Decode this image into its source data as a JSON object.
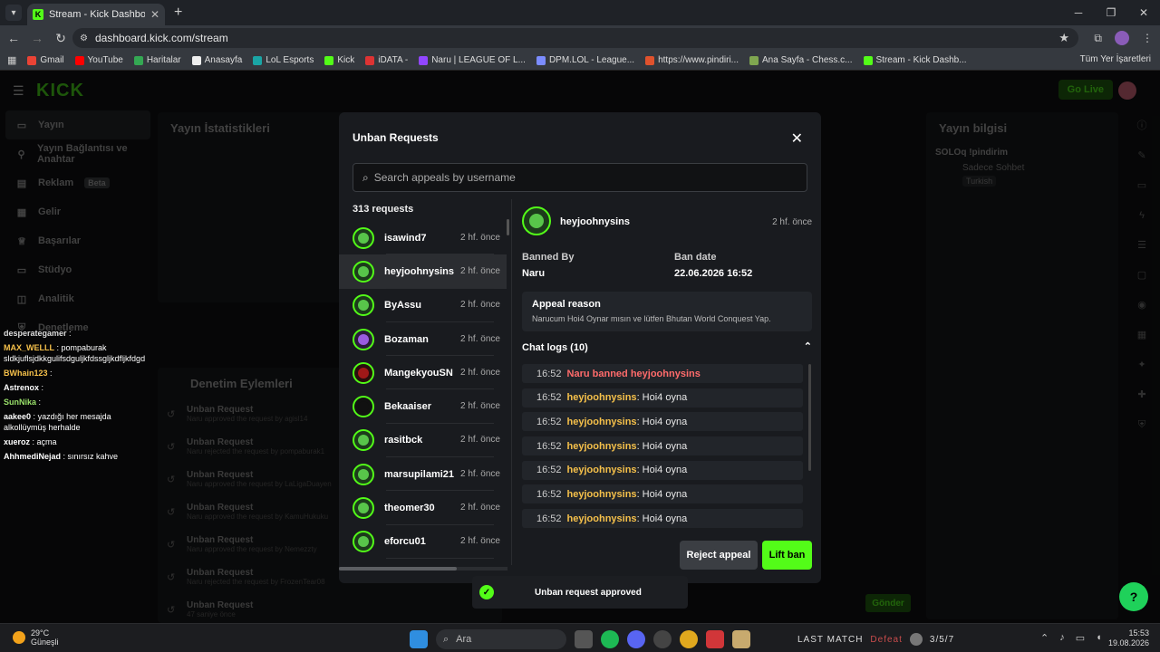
{
  "browser": {
    "tab_title": "Stream - Kick Dashboard",
    "url": "dashboard.kick.com/stream",
    "bookmarks": [
      "Gmail",
      "YouTube",
      "Haritalar",
      "Anasayfa",
      "LoL Esports",
      "Kick",
      "iDATA -",
      "Naru | LEAGUE OF L...",
      "DPM.LOL - League...",
      "https://www.pindiri...",
      "Ana Sayfa - Chess.c...",
      "Stream - Kick Dashb..."
    ],
    "all_bookmarks": "Tüm Yer İşaretleri"
  },
  "kick": {
    "go_live": "Go Live",
    "sidebar": [
      "Yayın",
      "Yayın Bağlantısı ve Anahtar",
      "Reklam",
      "Gelir",
      "Başarılar",
      "Stüdyo",
      "Analitik",
      "Denetleme"
    ],
    "sidebar_badge": "Beta",
    "stats_title": "Yayın İstatistikleri",
    "mod_title": "Denetim Eylemleri",
    "mod_rows": [
      {
        "title": "Unban Request",
        "sub": "Naru approved the request by agisl14"
      },
      {
        "title": "Unban Request",
        "sub": "Naru rejected the request by pompaburak1"
      },
      {
        "title": "Unban Request",
        "sub": "Naru approved the request by LaLigaDuayen"
      },
      {
        "title": "Unban Request",
        "sub": "Naru approved the request by KamuHukuku"
      },
      {
        "title": "Unban Request",
        "sub": "Naru approved the request by Nemezzty"
      },
      {
        "title": "Unban Request",
        "sub": "Naru rejected the request by FrozenTear08"
      },
      {
        "title": "Unban Request",
        "sub": "47 saniye önce"
      }
    ],
    "info_title": "Yayın bilgisi",
    "info_stream": "SOLOq !pindirim",
    "info_cat": "Sadece Sohbet",
    "info_tag": "Turkish",
    "send": "Gönder",
    "chat_overlay": [
      {
        "name": "desperategamer",
        "msg": ""
      },
      {
        "name": "MAX_WELLL",
        "msg": "pompaburak sldkjuflsjdkkgulifsdguljkfdssgljkdfljkfdgd"
      },
      {
        "name": "BWhain123",
        "msg": ""
      },
      {
        "name": "Astrenox",
        "msg": ""
      },
      {
        "name": "SunNika",
        "msg": ""
      },
      {
        "name": "aakee0",
        "msg": "yazdığı her mesajda alkollüymüş herhalde"
      },
      {
        "name": "xueroz",
        "msg": "açma"
      },
      {
        "name": "AhhmediNejad",
        "msg": "sınırsız kahve"
      }
    ]
  },
  "modal": {
    "title": "Unban Requests",
    "search_placeholder": "Search appeals by username",
    "count": "313 requests",
    "requests": [
      {
        "name": "isawind7",
        "ago": "2 hf. önce"
      },
      {
        "name": "heyjoohnysins",
        "ago": "2 hf. önce"
      },
      {
        "name": "ByAssu",
        "ago": "2 hf. önce"
      },
      {
        "name": "Bozaman",
        "ago": "2 hf. önce"
      },
      {
        "name": "MangekyouSN",
        "ago": "2 hf. önce"
      },
      {
        "name": "Bekaaiser",
        "ago": "2 hf. önce"
      },
      {
        "name": "rasitbck",
        "ago": "2 hf. önce"
      },
      {
        "name": "marsupilami21",
        "ago": "2 hf. önce"
      },
      {
        "name": "theomer30",
        "ago": "2 hf. önce"
      },
      {
        "name": "eforcu01",
        "ago": "2 hf. önce"
      }
    ],
    "selected": {
      "name": "heyjoohnysins",
      "ago": "2 hf. önce",
      "banned_by_label": "Banned By",
      "banned_by": "Naru",
      "ban_date_label": "Ban date",
      "ban_date": "22.06.2026 16:52",
      "reason_label": "Appeal reason",
      "reason": "Narucum Hoi4 Oynar mısın ve lütfen Bhutan World Conquest Yap.",
      "chat_logs_label": "Chat logs (10)",
      "logs": [
        {
          "time": "16:52",
          "user": "Naru banned heyjoohnysins",
          "msg": "",
          "type": "ban"
        },
        {
          "time": "16:52",
          "user": "heyjoohnysins",
          "msg": ": Hoi4 oyna",
          "type": "msg"
        },
        {
          "time": "16:52",
          "user": "heyjoohnysins",
          "msg": ": Hoi4 oyna",
          "type": "msg"
        },
        {
          "time": "16:52",
          "user": "heyjoohnysins",
          "msg": ": Hoi4 oyna",
          "type": "msg"
        },
        {
          "time": "16:52",
          "user": "heyjoohnysins",
          "msg": ": Hoi4 oyna",
          "type": "msg"
        },
        {
          "time": "16:52",
          "user": "heyjoohnysins",
          "msg": ": Hoi4 oyna",
          "type": "msg"
        },
        {
          "time": "16:52",
          "user": "heyjoohnysins",
          "msg": ": Hoi4 oyna",
          "type": "msg"
        }
      ]
    },
    "reject": "Reject appeal",
    "lift": "Lift ban"
  },
  "toast": "Unban request approved",
  "taskbar": {
    "temp": "29°C",
    "weather": "Güneşli",
    "search": "Ara",
    "last_match": "LAST MATCH",
    "result": "Defeat",
    "kda": "3/5/7",
    "time": "15:53",
    "date": "19.08.2026"
  },
  "colors": {
    "accent": "#53fc18",
    "ban": "#ff6b6b",
    "user": "#f5c04a"
  }
}
